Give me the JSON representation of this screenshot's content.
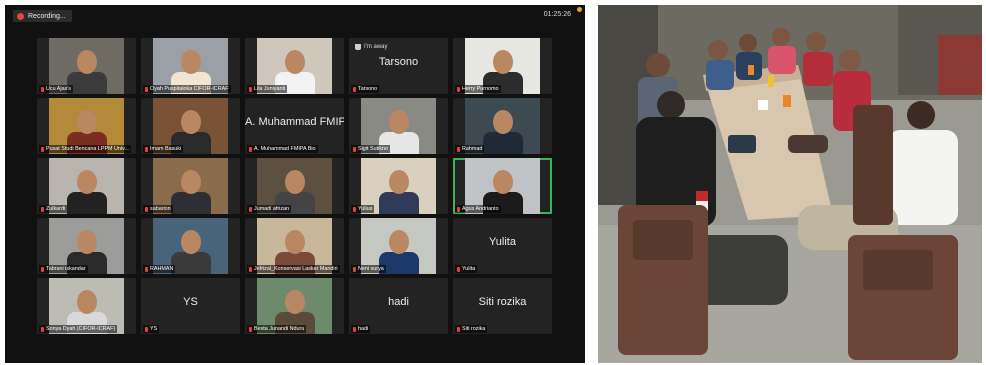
{
  "zoom": {
    "recording_label": "Recording...",
    "timer": "01:25:26",
    "colors": {
      "background": "#111111",
      "tile": "#232323",
      "active_border": "#3db35b",
      "muted_icon": "#e04040"
    },
    "tiles": [
      {
        "name": "Ucu Ajas's",
        "video": true
      },
      {
        "name": "Oyah Puspitaloka CIFOR-ICRAF",
        "video": true
      },
      {
        "name": "Lila Juniyanti",
        "video": true
      },
      {
        "name": "Tarsono",
        "video": false,
        "big": "Tarsono",
        "status": "I'm away"
      },
      {
        "name": "Herry Purnomo",
        "video": true
      },
      {
        "name": "Pusat Studi Bencana LPPM Univ...",
        "video": true
      },
      {
        "name": "Imam Basuki",
        "video": true
      },
      {
        "name": "A. Muhammad FMIPA Bio",
        "video": false,
        "big": "A. Muhammad FMIP..."
      },
      {
        "name": "Sigit Sutikno",
        "video": true
      },
      {
        "name": "Rahmad",
        "video": true
      },
      {
        "name": "Zulkardi",
        "video": true
      },
      {
        "name": "sabarion",
        "video": true
      },
      {
        "name": "Jumadi afrizan",
        "video": true
      },
      {
        "name": "Yulius",
        "video": true
      },
      {
        "name": "Agus Andrianto",
        "video": true,
        "active": true
      },
      {
        "name": "Tabrani iskandar",
        "video": true
      },
      {
        "name": "RAHMAN",
        "video": true
      },
      {
        "name": "Jefrizal_Konservasi Laskar Mandiri",
        "video": true
      },
      {
        "name": "Neni surya",
        "video": true
      },
      {
        "name": "Yulita",
        "video": false,
        "big": "Yulita"
      },
      {
        "name": "Sonya Dyah (CIFOR-ICRAF)",
        "video": true
      },
      {
        "name": "YS",
        "video": false,
        "big": "YS"
      },
      {
        "name": "Besta Junandi Nduru",
        "video": true
      },
      {
        "name": "hadi",
        "video": false,
        "big": "hadi"
      },
      {
        "name": "Siti rozika",
        "video": false,
        "big": "Siti rozika"
      }
    ]
  }
}
